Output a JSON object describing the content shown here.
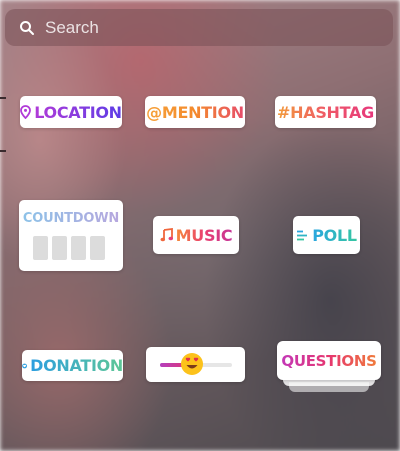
{
  "search": {
    "placeholder": "Search",
    "icon": "search-icon"
  },
  "stickers": {
    "location": {
      "label": "LOCATION",
      "icon": "location-pin-icon"
    },
    "mention": {
      "label": "@MENTION"
    },
    "hashtag": {
      "label": "#HASHTAG"
    },
    "countdown": {
      "label": "COUNTDOWN"
    },
    "music": {
      "label": "MUSIC",
      "icon": "music-note-icon"
    },
    "poll": {
      "label": "POLL",
      "icon": "poll-lines-icon"
    },
    "donation": {
      "label": "DONATION",
      "icon": "heart-icon"
    },
    "emoji_slider": {
      "emoji": "heart-eyes-emoji",
      "level": 0.45
    },
    "questions": {
      "label": "QUESTIONS"
    }
  },
  "colors": {
    "location": "#6a3ce4",
    "mention": "#f48a2c",
    "hashtag": "#ef5a67",
    "music": "#ea3f6f",
    "poll": "#2aa6e0",
    "donation": "#2c9ee0",
    "questions": "#e6366f"
  }
}
